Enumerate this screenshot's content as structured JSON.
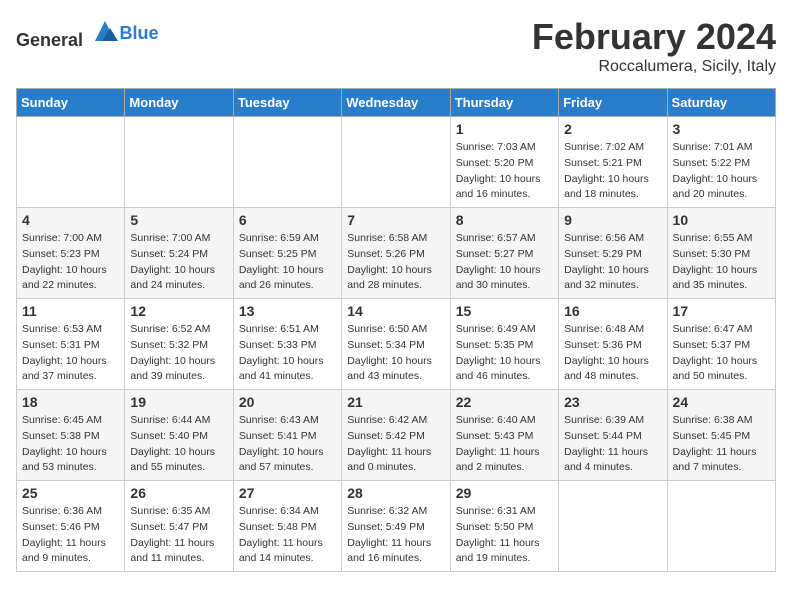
{
  "header": {
    "logo_general": "General",
    "logo_blue": "Blue",
    "main_title": "February 2024",
    "sub_title": "Roccalumera, Sicily, Italy"
  },
  "days_of_week": [
    "Sunday",
    "Monday",
    "Tuesday",
    "Wednesday",
    "Thursday",
    "Friday",
    "Saturday"
  ],
  "weeks": [
    [
      {
        "day": "",
        "sunrise": "",
        "sunset": "",
        "daylight": ""
      },
      {
        "day": "",
        "sunrise": "",
        "sunset": "",
        "daylight": ""
      },
      {
        "day": "",
        "sunrise": "",
        "sunset": "",
        "daylight": ""
      },
      {
        "day": "",
        "sunrise": "",
        "sunset": "",
        "daylight": ""
      },
      {
        "day": "1",
        "sunrise": "Sunrise: 7:03 AM",
        "sunset": "Sunset: 5:20 PM",
        "daylight": "Daylight: 10 hours and 16 minutes."
      },
      {
        "day": "2",
        "sunrise": "Sunrise: 7:02 AM",
        "sunset": "Sunset: 5:21 PM",
        "daylight": "Daylight: 10 hours and 18 minutes."
      },
      {
        "day": "3",
        "sunrise": "Sunrise: 7:01 AM",
        "sunset": "Sunset: 5:22 PM",
        "daylight": "Daylight: 10 hours and 20 minutes."
      }
    ],
    [
      {
        "day": "4",
        "sunrise": "Sunrise: 7:00 AM",
        "sunset": "Sunset: 5:23 PM",
        "daylight": "Daylight: 10 hours and 22 minutes."
      },
      {
        "day": "5",
        "sunrise": "Sunrise: 7:00 AM",
        "sunset": "Sunset: 5:24 PM",
        "daylight": "Daylight: 10 hours and 24 minutes."
      },
      {
        "day": "6",
        "sunrise": "Sunrise: 6:59 AM",
        "sunset": "Sunset: 5:25 PM",
        "daylight": "Daylight: 10 hours and 26 minutes."
      },
      {
        "day": "7",
        "sunrise": "Sunrise: 6:58 AM",
        "sunset": "Sunset: 5:26 PM",
        "daylight": "Daylight: 10 hours and 28 minutes."
      },
      {
        "day": "8",
        "sunrise": "Sunrise: 6:57 AM",
        "sunset": "Sunset: 5:27 PM",
        "daylight": "Daylight: 10 hours and 30 minutes."
      },
      {
        "day": "9",
        "sunrise": "Sunrise: 6:56 AM",
        "sunset": "Sunset: 5:29 PM",
        "daylight": "Daylight: 10 hours and 32 minutes."
      },
      {
        "day": "10",
        "sunrise": "Sunrise: 6:55 AM",
        "sunset": "Sunset: 5:30 PM",
        "daylight": "Daylight: 10 hours and 35 minutes."
      }
    ],
    [
      {
        "day": "11",
        "sunrise": "Sunrise: 6:53 AM",
        "sunset": "Sunset: 5:31 PM",
        "daylight": "Daylight: 10 hours and 37 minutes."
      },
      {
        "day": "12",
        "sunrise": "Sunrise: 6:52 AM",
        "sunset": "Sunset: 5:32 PM",
        "daylight": "Daylight: 10 hours and 39 minutes."
      },
      {
        "day": "13",
        "sunrise": "Sunrise: 6:51 AM",
        "sunset": "Sunset: 5:33 PM",
        "daylight": "Daylight: 10 hours and 41 minutes."
      },
      {
        "day": "14",
        "sunrise": "Sunrise: 6:50 AM",
        "sunset": "Sunset: 5:34 PM",
        "daylight": "Daylight: 10 hours and 43 minutes."
      },
      {
        "day": "15",
        "sunrise": "Sunrise: 6:49 AM",
        "sunset": "Sunset: 5:35 PM",
        "daylight": "Daylight: 10 hours and 46 minutes."
      },
      {
        "day": "16",
        "sunrise": "Sunrise: 6:48 AM",
        "sunset": "Sunset: 5:36 PM",
        "daylight": "Daylight: 10 hours and 48 minutes."
      },
      {
        "day": "17",
        "sunrise": "Sunrise: 6:47 AM",
        "sunset": "Sunset: 5:37 PM",
        "daylight": "Daylight: 10 hours and 50 minutes."
      }
    ],
    [
      {
        "day": "18",
        "sunrise": "Sunrise: 6:45 AM",
        "sunset": "Sunset: 5:38 PM",
        "daylight": "Daylight: 10 hours and 53 minutes."
      },
      {
        "day": "19",
        "sunrise": "Sunrise: 6:44 AM",
        "sunset": "Sunset: 5:40 PM",
        "daylight": "Daylight: 10 hours and 55 minutes."
      },
      {
        "day": "20",
        "sunrise": "Sunrise: 6:43 AM",
        "sunset": "Sunset: 5:41 PM",
        "daylight": "Daylight: 10 hours and 57 minutes."
      },
      {
        "day": "21",
        "sunrise": "Sunrise: 6:42 AM",
        "sunset": "Sunset: 5:42 PM",
        "daylight": "Daylight: 11 hours and 0 minutes."
      },
      {
        "day": "22",
        "sunrise": "Sunrise: 6:40 AM",
        "sunset": "Sunset: 5:43 PM",
        "daylight": "Daylight: 11 hours and 2 minutes."
      },
      {
        "day": "23",
        "sunrise": "Sunrise: 6:39 AM",
        "sunset": "Sunset: 5:44 PM",
        "daylight": "Daylight: 11 hours and 4 minutes."
      },
      {
        "day": "24",
        "sunrise": "Sunrise: 6:38 AM",
        "sunset": "Sunset: 5:45 PM",
        "daylight": "Daylight: 11 hours and 7 minutes."
      }
    ],
    [
      {
        "day": "25",
        "sunrise": "Sunrise: 6:36 AM",
        "sunset": "Sunset: 5:46 PM",
        "daylight": "Daylight: 11 hours and 9 minutes."
      },
      {
        "day": "26",
        "sunrise": "Sunrise: 6:35 AM",
        "sunset": "Sunset: 5:47 PM",
        "daylight": "Daylight: 11 hours and 11 minutes."
      },
      {
        "day": "27",
        "sunrise": "Sunrise: 6:34 AM",
        "sunset": "Sunset: 5:48 PM",
        "daylight": "Daylight: 11 hours and 14 minutes."
      },
      {
        "day": "28",
        "sunrise": "Sunrise: 6:32 AM",
        "sunset": "Sunset: 5:49 PM",
        "daylight": "Daylight: 11 hours and 16 minutes."
      },
      {
        "day": "29",
        "sunrise": "Sunrise: 6:31 AM",
        "sunset": "Sunset: 5:50 PM",
        "daylight": "Daylight: 11 hours and 19 minutes."
      },
      {
        "day": "",
        "sunrise": "",
        "sunset": "",
        "daylight": ""
      },
      {
        "day": "",
        "sunrise": "",
        "sunset": "",
        "daylight": ""
      }
    ]
  ]
}
